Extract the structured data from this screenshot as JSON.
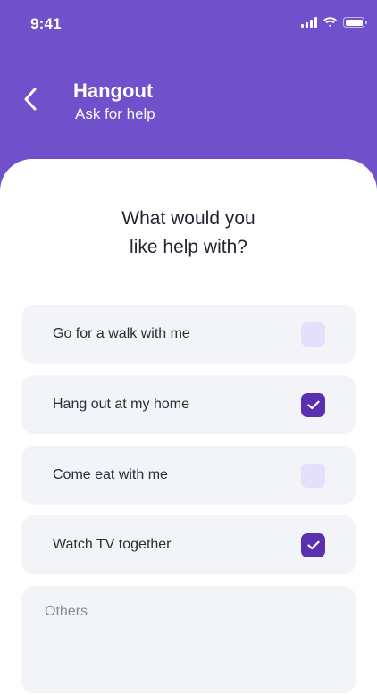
{
  "status_bar": {
    "time": "9:41"
  },
  "header": {
    "title": "Hangout",
    "subtitle": "Ask for help"
  },
  "question": {
    "line1": "What would you",
    "line2": "like help with?"
  },
  "options": [
    {
      "label": "Go for a walk with me",
      "checked": false
    },
    {
      "label": "Hang out at my home",
      "checked": true
    },
    {
      "label": "Come eat with me",
      "checked": false
    },
    {
      "label": "Watch TV together",
      "checked": true
    }
  ],
  "others": {
    "placeholder": "Others",
    "value": ""
  },
  "colors": {
    "accent": "#7050cb",
    "checkbox_checked": "#5a2fb0",
    "checkbox_unchecked": "#e4e0fb",
    "card": "#f3f4f8"
  },
  "icons": {
    "back": "chevron-left-icon",
    "check": "checkmark-icon"
  }
}
